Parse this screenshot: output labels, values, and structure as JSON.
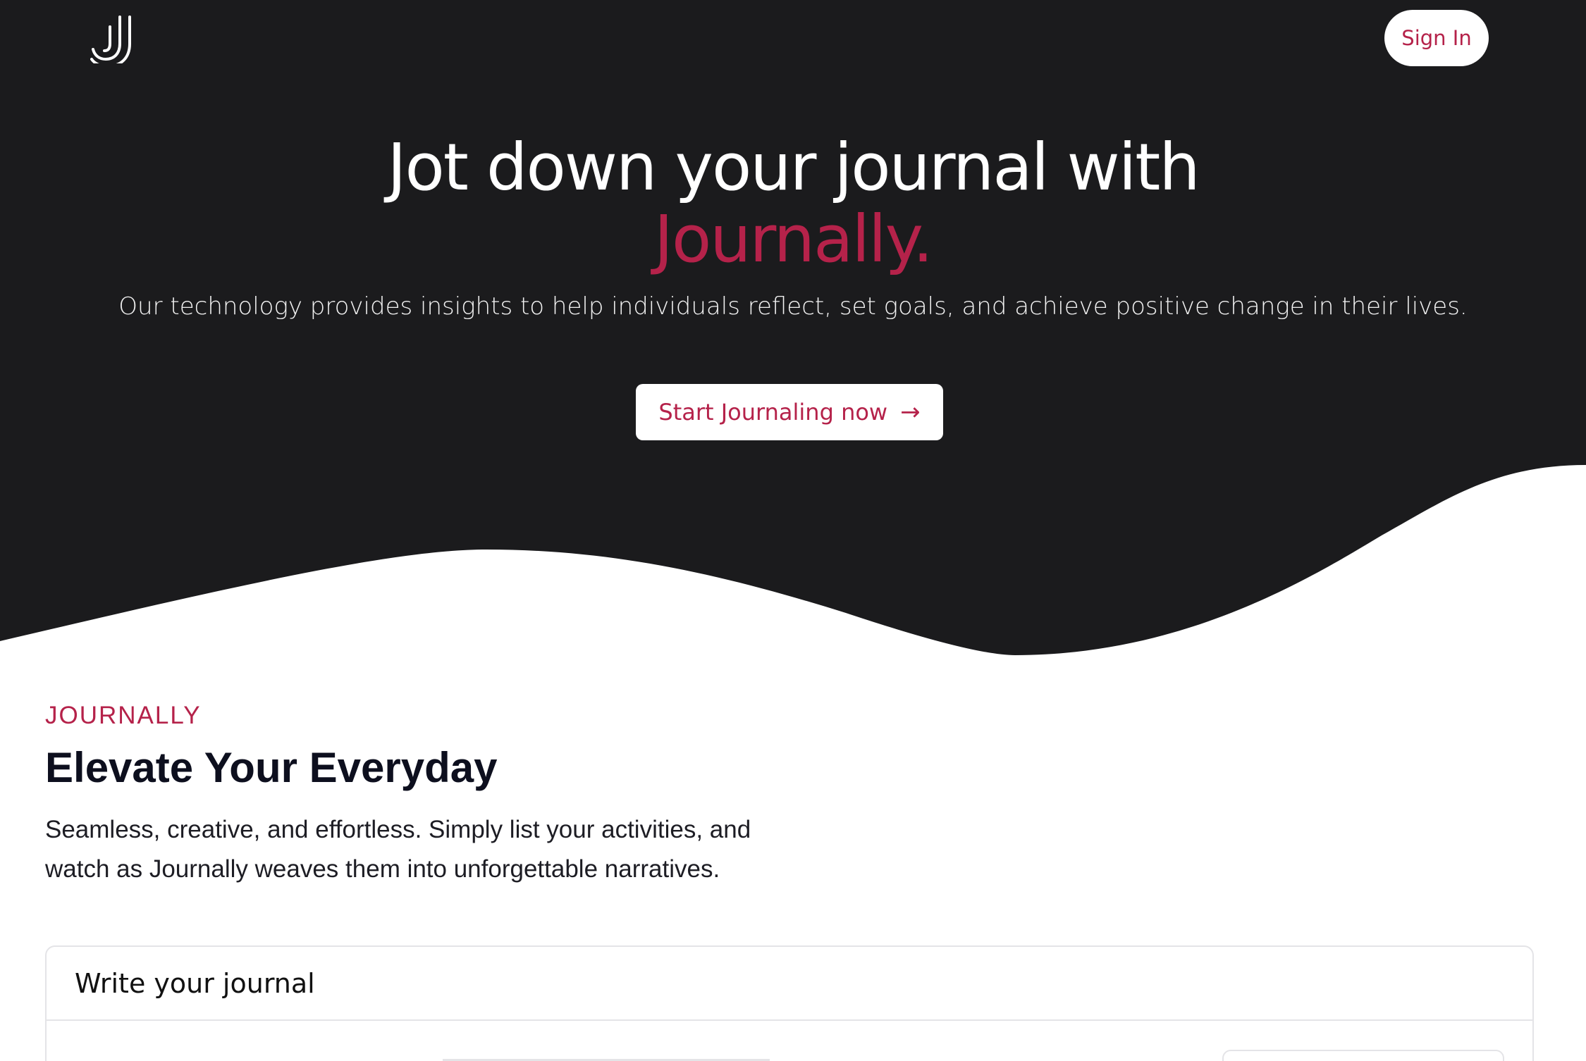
{
  "header": {
    "logo_icon": "journally-j-logo-icon",
    "signin_label": "Sign In"
  },
  "hero": {
    "headline": "Jot down your journal with",
    "headline_accent": "Journally.",
    "subtitle": "Our technology provides insights to help individuals reflect, set goals, and achieve positive change in their lives.",
    "cta_label": "Start Journaling now",
    "cta_icon": "arrow-right-icon",
    "cta_arrow": "→"
  },
  "section": {
    "eyebrow": "JOURNALLY",
    "title": "Elevate Your Everyday",
    "description": "Seamless, creative, and effortless. Simply list your activities, and watch as Journally weaves them into unforgettable narratives."
  },
  "card": {
    "title": "Write your journal"
  },
  "colors": {
    "hero_background": "#1b1b1d",
    "accent": "#b5224a",
    "page_background": "#ffffff",
    "text_dark": "#0d0f1e"
  }
}
